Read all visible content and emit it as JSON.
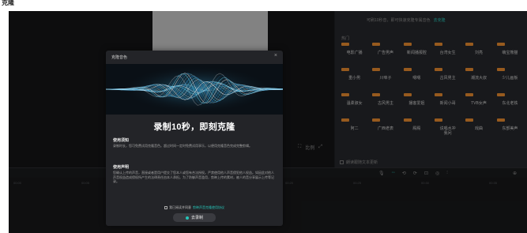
{
  "page": {
    "corner_label": "克隆"
  },
  "preview": {
    "controls": [
      "⛶",
      "比例",
      "⤢"
    ]
  },
  "panel": {
    "header_text": "可刷10秒音，即可快速克隆专属音色",
    "header_link": "去克隆",
    "section_label": "热门",
    "voices": [
      "电影广播",
      "广告男声",
      "新闻播报腔",
      "台湾女生",
      "刘亮",
      "萌宝熊猫",
      "重小男",
      "川味子",
      "嗯嗯",
      "古风男主",
      "潮流大叔",
      "少儿画板",
      "温柔淑女",
      "古风男主",
      "播客爱姐",
      "新闻小哥",
      "TVB女声",
      "东北老铁",
      "阿二",
      "广西老表",
      "殿殿",
      "说唱水冲",
      "戏曲",
      "东部美声"
    ],
    "voice_sublabels": {
      "21": "我问"
    },
    "footer_label": "朗读跟随文本更新"
  },
  "toolbar": {
    "tools": [
      "🎙",
      "◦◦",
      "⟲",
      "⟳",
      "⊡",
      "◎",
      "⫶"
    ],
    "zoom": "⊕"
  },
  "ruler": {
    "ticks": [
      "00:00",
      "00:05",
      "00:10",
      "00:15",
      "00:20",
      "00:25",
      "00:30",
      "00:35"
    ]
  },
  "modal": {
    "title": "克隆音色",
    "close": "×",
    "headline": "录制10秒，即刻克隆",
    "usage_title": "使用须知",
    "usage_text": "录制时长，您可免费试用克隆音色。超过时间一定时免费试用享乐，以便用克隆音色完成完整剪辑。",
    "rules_title": "使用声明",
    "rules_text": "您确认上传的声音，直接或者是用户提交了您本人或您有合法授权。严禁使用他人声音侵犯他人权益。如因此对他人声音权益造成侵权所产生的法律责任由本人承担。为了防御声音滥用，剪映上传的素材，被人的音分享展示上传等记录。",
    "agree_prefix": "我已阅读并同意",
    "agree_link": "剪映声音克隆使用协议",
    "record_button": "去录制"
  },
  "colors": {
    "accent": "#26c4b8",
    "badge": "#e88a2e",
    "preview": "#c8c8c8"
  }
}
